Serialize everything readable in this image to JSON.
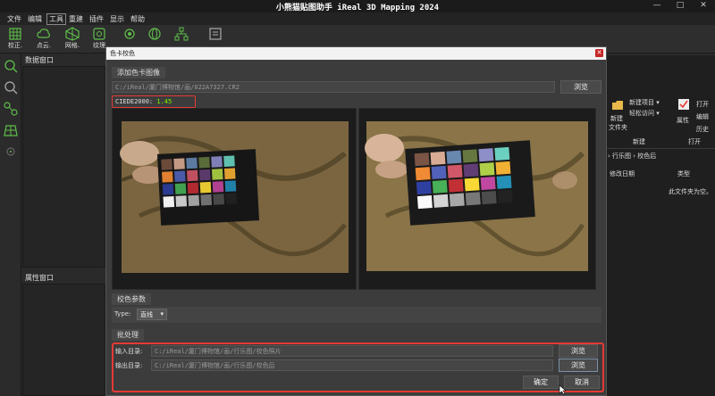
{
  "app": {
    "title": "小熊猫贴图助手 iReal 3D Mapping 2024",
    "window_controls": [
      "—",
      "□",
      "✕"
    ]
  },
  "menu": [
    "文件",
    "编辑",
    "工具",
    "重建",
    "插件",
    "显示",
    "帮助"
  ],
  "toolbar": [
    {
      "label": "校正.",
      "icon": "grid-icon"
    },
    {
      "label": "点云.",
      "icon": "cloud-icon"
    },
    {
      "label": "网格.",
      "icon": "mesh-icon"
    },
    {
      "label": "纹理",
      "icon": "texture-icon"
    }
  ],
  "panels": {
    "data": "数据窗口",
    "properties": "属性窗口"
  },
  "explorer": {
    "new_folder_line1": "新建",
    "new_folder_line2": "文件夹",
    "new_item": "新建项目 ▾",
    "easy_access": "轻松访问 ▾",
    "group_new": "新建",
    "properties": "属性",
    "open": "打开",
    "edit": "编辑",
    "history": "历史",
    "group_open": "打开",
    "breadcrumb": "› 行乐图 › 校色后",
    "col_date": "修改日期",
    "col_type": "类型",
    "empty": "此文件夹为空。"
  },
  "dialog": {
    "title": "色卡校色",
    "add_card_label": "添加色卡图像",
    "card_path": "C:/iReal/厦门博物馆/画/022A7327.CR2",
    "browse": "浏览",
    "ciede_label": "CIEDE2000:",
    "ciede_value": "1.45",
    "params_label": "校色参数",
    "type_label": "Type:",
    "type_value": "直线",
    "batch_label": "批处理",
    "input_label": "输入目录:",
    "input_path": "C:/iReal/厦门博物馆/画/行乐图/校色照片",
    "output_label": "输出目录:",
    "output_path": "C:/iReal/厦门博物馆/画/行乐图/校色后",
    "ok": "确定",
    "cancel": "取消"
  },
  "colors": {
    "accent_red": "#e53935",
    "ciede_green": "#7cfc00",
    "dialog_bg": "#3c3c3c",
    "toolbar_icon_green": "#5fbf4a"
  }
}
